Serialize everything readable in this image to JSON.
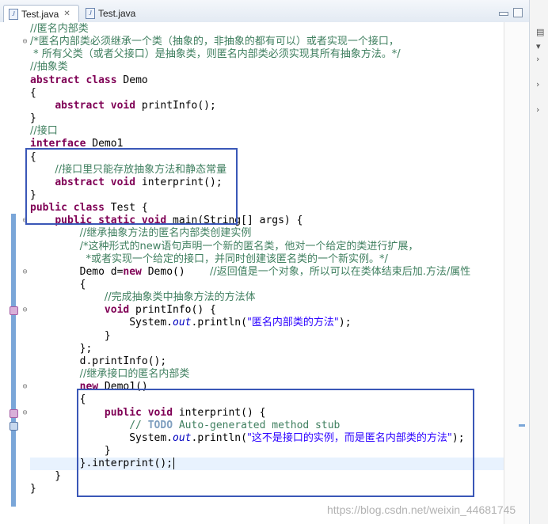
{
  "tabs": [
    {
      "label": "Test.java",
      "active": true
    },
    {
      "label": "Test.java",
      "active": false
    }
  ],
  "code_lines": [
    {
      "segments": [
        {
          "t": "//匿名内部类",
          "c": "cm cjk"
        }
      ]
    },
    {
      "segments": [
        {
          "t": "/*匿名内部类必须继承一个类（抽象的，非抽象的都有可以）或者实现一个接口，",
          "c": "cm cjk"
        }
      ]
    },
    {
      "segments": [
        {
          "t": " * 所有父类（或者父接口）是抽象类，则匿名内部类必须实现其所有抽象方法。*/",
          "c": "cm cjk"
        }
      ]
    },
    {
      "segments": [
        {
          "t": "//抽象类",
          "c": "cm cjk"
        }
      ]
    },
    {
      "segments": [
        {
          "t": "abstract",
          "c": "kw"
        },
        {
          "t": " "
        },
        {
          "t": "class",
          "c": "kw"
        },
        {
          "t": " Demo"
        }
      ]
    },
    {
      "segments": [
        {
          "t": "{"
        }
      ]
    },
    {
      "segments": [
        {
          "t": "    "
        },
        {
          "t": "abstract",
          "c": "kw"
        },
        {
          "t": " "
        },
        {
          "t": "void",
          "c": "kw"
        },
        {
          "t": " printInfo();"
        }
      ]
    },
    {
      "segments": [
        {
          "t": "}"
        }
      ]
    },
    {
      "segments": [
        {
          "t": "//接口",
          "c": "cm cjk"
        }
      ]
    },
    {
      "segments": [
        {
          "t": "interface",
          "c": "kw"
        },
        {
          "t": " Demo1"
        }
      ]
    },
    {
      "segments": [
        {
          "t": "{"
        }
      ]
    },
    {
      "segments": [
        {
          "t": "    "
        },
        {
          "t": "//接口里只能存放抽象方法和静态常量",
          "c": "cm cjk"
        }
      ]
    },
    {
      "segments": [
        {
          "t": "    "
        },
        {
          "t": "abstract",
          "c": "kw"
        },
        {
          "t": " "
        },
        {
          "t": "void",
          "c": "kw"
        },
        {
          "t": " interprint();"
        }
      ]
    },
    {
      "segments": [
        {
          "t": "}"
        }
      ]
    },
    {
      "segments": [
        {
          "t": "public",
          "c": "kw"
        },
        {
          "t": " "
        },
        {
          "t": "class",
          "c": "kw"
        },
        {
          "t": " Test {"
        }
      ]
    },
    {
      "segments": [
        {
          "t": "    "
        },
        {
          "t": "public",
          "c": "kw"
        },
        {
          "t": " "
        },
        {
          "t": "static",
          "c": "kw"
        },
        {
          "t": " "
        },
        {
          "t": "void",
          "c": "kw"
        },
        {
          "t": " main(String[] args) {"
        }
      ]
    },
    {
      "segments": [
        {
          "t": "        "
        },
        {
          "t": "//继承抽象方法的匿名内部类创建实例",
          "c": "cm cjk"
        }
      ]
    },
    {
      "segments": [
        {
          "t": "        "
        },
        {
          "t": "/*这种形式的new语句声明一个新的匿名类，他对一个给定的类进行扩展，",
          "c": "cm cjk"
        }
      ]
    },
    {
      "segments": [
        {
          "t": "         "
        },
        {
          "t": "*或者实现一个给定的接口，并同时创建该匿名类的一个新实例。*/",
          "c": "cm cjk"
        }
      ]
    },
    {
      "segments": [
        {
          "t": "        Demo d="
        },
        {
          "t": "new",
          "c": "kw"
        },
        {
          "t": " Demo()    "
        },
        {
          "t": "//返回值是一个对象，所以可以在类体结束后加.方法/属性",
          "c": "cm cjk"
        }
      ]
    },
    {
      "segments": [
        {
          "t": "        {"
        }
      ]
    },
    {
      "segments": [
        {
          "t": "            "
        },
        {
          "t": "//完成抽象类中抽象方法的方法体",
          "c": "cm cjk"
        }
      ]
    },
    {
      "segments": [
        {
          "t": "            "
        },
        {
          "t": "void",
          "c": "kw"
        },
        {
          "t": " printInfo() {"
        }
      ]
    },
    {
      "segments": [
        {
          "t": "                System."
        },
        {
          "t": "out",
          "c": "it"
        },
        {
          "t": ".println("
        },
        {
          "t": "\"匿名内部类的方法\"",
          "c": "str cjk"
        },
        {
          "t": ");"
        }
      ]
    },
    {
      "segments": [
        {
          "t": "            }"
        }
      ]
    },
    {
      "segments": [
        {
          "t": "        };"
        }
      ]
    },
    {
      "segments": [
        {
          "t": "        d.printInfo();"
        }
      ]
    },
    {
      "segments": [
        {
          "t": "        "
        },
        {
          "t": "//继承接口的匿名内部类",
          "c": "cm cjk"
        }
      ]
    },
    {
      "segments": [
        {
          "t": "        "
        },
        {
          "t": "new",
          "c": "kw"
        },
        {
          "t": " Demo1()"
        }
      ]
    },
    {
      "segments": [
        {
          "t": "        {"
        }
      ]
    },
    {
      "segments": [
        {
          "t": "            "
        },
        {
          "t": "public",
          "c": "kw"
        },
        {
          "t": " "
        },
        {
          "t": "void",
          "c": "kw"
        },
        {
          "t": " interprint() {"
        }
      ]
    },
    {
      "segments": [
        {
          "t": "                "
        },
        {
          "t": "// ",
          "c": "cm"
        },
        {
          "t": "TODO",
          "c": "todo"
        },
        {
          "t": " Auto-generated method stub",
          "c": "cm"
        }
      ]
    },
    {
      "segments": [
        {
          "t": "                System."
        },
        {
          "t": "out",
          "c": "it"
        },
        {
          "t": ".println("
        },
        {
          "t": "\"这不是接口的实例，而是匿名内部类的方法\"",
          "c": "str cjk"
        },
        {
          "t": ");"
        }
      ]
    },
    {
      "segments": [
        {
          "t": "            }"
        }
      ]
    },
    {
      "segments": [
        {
          "t": "        }.interprint();"
        }
      ],
      "current": true
    },
    {
      "segments": [
        {
          "t": "    }"
        }
      ]
    },
    {
      "segments": [
        {
          "t": "}"
        }
      ]
    }
  ],
  "fold_markers": [
    {
      "line": 1,
      "symbol": "⊖"
    },
    {
      "line": 15,
      "symbol": "⊖"
    },
    {
      "line": 19,
      "symbol": "⊖"
    },
    {
      "line": 22,
      "symbol": "⊖"
    },
    {
      "line": 28,
      "symbol": "⊖"
    },
    {
      "line": 30,
      "symbol": "⊖"
    }
  ],
  "gutter_markers": [
    {
      "line": 22,
      "kind": "override"
    },
    {
      "line": 30,
      "kind": "override"
    },
    {
      "line": 31,
      "kind": "task"
    }
  ],
  "watermark": "https://blog.csdn.net/weixin_44681745",
  "icons": {
    "file": "java-file-icon",
    "close": "close-icon",
    "minimize": "minimize-icon",
    "maximize": "maximize-icon"
  }
}
